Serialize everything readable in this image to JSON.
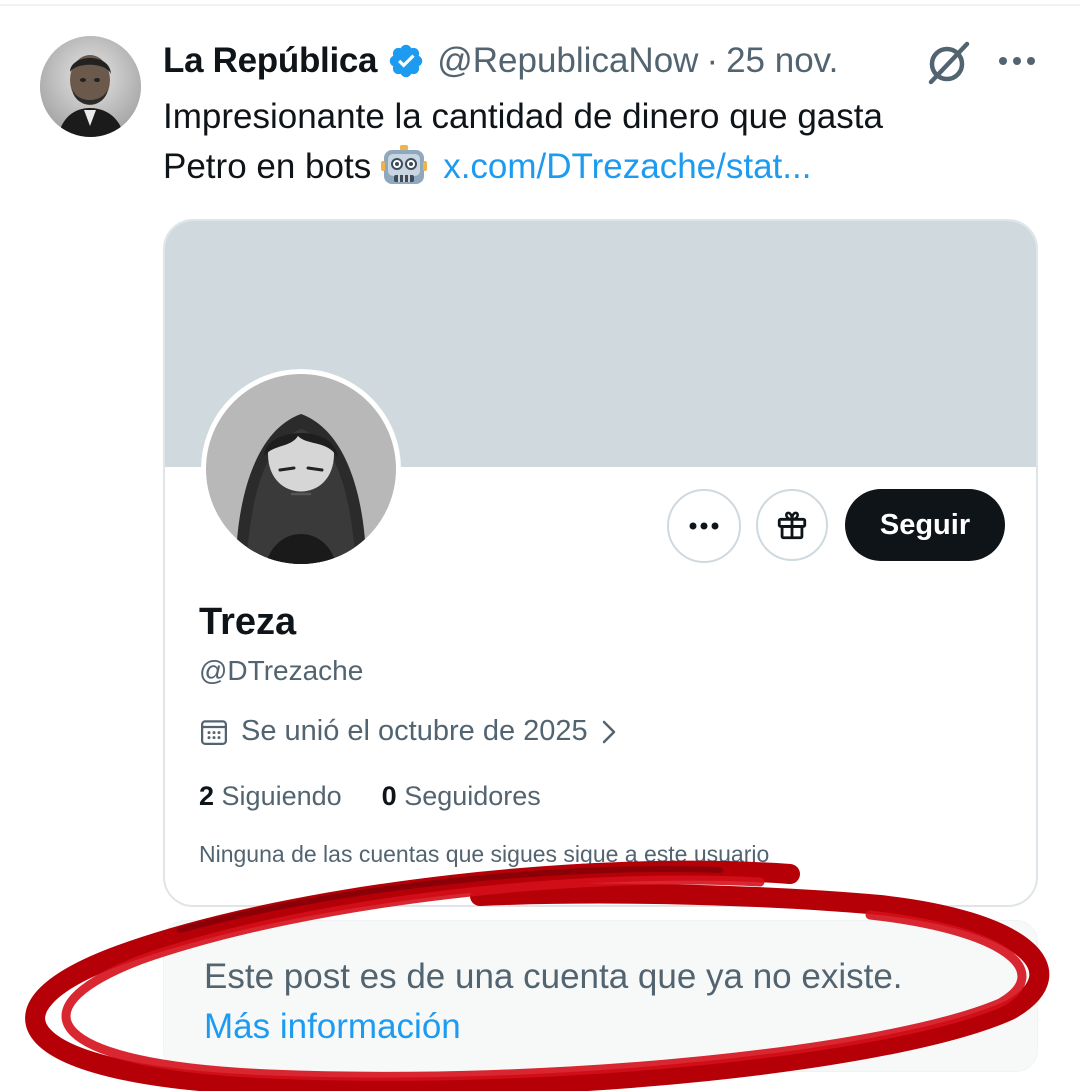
{
  "tweet": {
    "author_name": "La República",
    "handle": "@RepublicaNow",
    "separator": "·",
    "date": "25 nov.",
    "text_line1": "Impresionante la cantidad de dinero que gasta",
    "text_line2": "Petro en bots",
    "emoji": "robot-face",
    "link_text": "x.com/DTrezache/stat..."
  },
  "icons": {
    "verified": "verified-badge-icon",
    "grok": "grok-icon",
    "more": "more-icon"
  },
  "profile_card": {
    "name": "Treza",
    "handle": "@DTrezache",
    "joined": "Se unió el octubre de 2025",
    "following_count": "2",
    "following_label": "Siguiendo",
    "followers_count": "0",
    "followers_label": "Seguidores",
    "mutuals_text": "Ninguna de las cuentas que sigues sigue a este usuario",
    "follow_button": "Seguir"
  },
  "notice": {
    "text": "Este post es de una cuenta que ya no existe.",
    "link": "Más información"
  },
  "colors": {
    "accent": "#1d9bf0",
    "text": "#0f1419",
    "secondary": "#536471",
    "banner": "#cfd9de",
    "annotation_red": "#c00008"
  }
}
